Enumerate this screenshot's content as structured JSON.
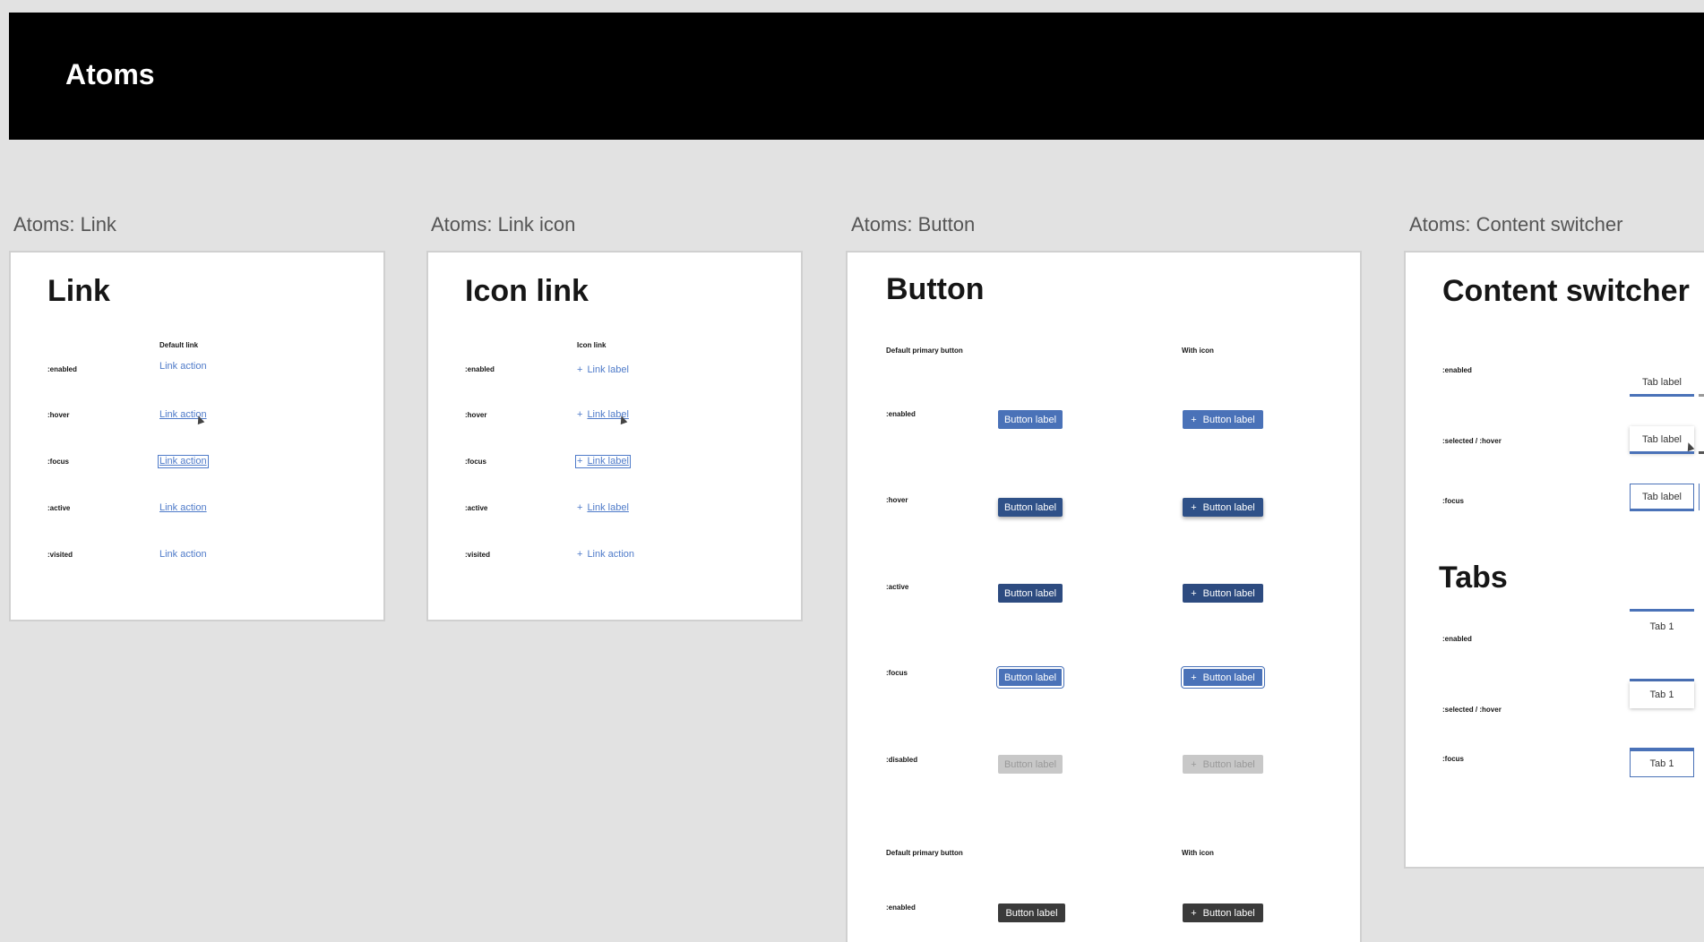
{
  "header": {
    "title": "Atoms"
  },
  "frames": {
    "link": "Atoms: Link",
    "link_icon": "Atoms: Link icon",
    "button": "Atoms: Button",
    "content_switcher": "Atoms: Content switcher"
  },
  "link_card": {
    "title": "Link",
    "column": "Default link",
    "states": [
      ":enabled",
      ":hover",
      ":focus",
      ":active",
      ":visited"
    ],
    "links": [
      "Link action",
      "Link action",
      "Link action",
      "Link action",
      "Link action"
    ]
  },
  "icon_link_card": {
    "title": "Icon link",
    "column": "Icon link",
    "states": [
      ":enabled",
      ":hover",
      ":focus",
      ":active",
      ":visited"
    ],
    "links": [
      "Link label",
      "Link label",
      "Link label",
      "Link label",
      "Link action"
    ],
    "icon": "plus-icon"
  },
  "button_card": {
    "title": "Button",
    "col1": "Default primary button",
    "col2": "With icon",
    "states": [
      ":enabled",
      ":hover",
      ":active",
      ":focus",
      ":disabled"
    ],
    "button_label": "Button label",
    "second_col1": "Default primary button",
    "second_col2": "With icon",
    "second_state": ":enabled",
    "colors": {
      "primary": "#4a72b8",
      "hover": "#2f5188",
      "disabled": "#c8c8c8",
      "dark": "#3a3a3a"
    }
  },
  "content_switcher_card": {
    "title": "Content switcher",
    "states": [
      ":enabled",
      ":selected / :hover",
      ":focus"
    ],
    "tab_label": "Tab label",
    "tabs_title": "Tabs",
    "tab_states": [
      ":enabled",
      ":selected / :hover",
      ":focus"
    ],
    "tab1_label": "Tab 1"
  }
}
